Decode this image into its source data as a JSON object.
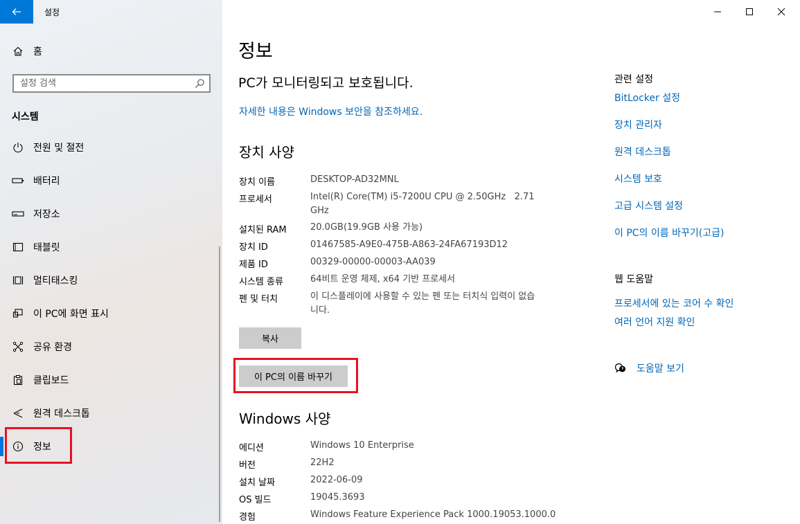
{
  "window": {
    "title": "설정",
    "controls": [
      "minimize-icon",
      "maximize-icon",
      "close-icon"
    ]
  },
  "sidebar": {
    "home_label": "홈",
    "search": {
      "placeholder": "설정 검색"
    },
    "section_label": "시스템",
    "items": [
      {
        "label": "전원 및 절전",
        "icon": "power-icon"
      },
      {
        "label": "배터리",
        "icon": "battery-icon"
      },
      {
        "label": "저장소",
        "icon": "storage-icon"
      },
      {
        "label": "태블릿",
        "icon": "tablet-icon"
      },
      {
        "label": "멀티태스킹",
        "icon": "multitasking-icon"
      },
      {
        "label": "이 PC에 화면 표시",
        "icon": "projecting-icon"
      },
      {
        "label": "공유 환경",
        "icon": "shared-experiences-icon"
      },
      {
        "label": "클립보드",
        "icon": "clipboard-icon"
      },
      {
        "label": "원격 데스크톱",
        "icon": "remote-desktop-icon"
      },
      {
        "label": "정보",
        "icon": "info-icon",
        "active": true
      }
    ]
  },
  "main": {
    "title": "정보",
    "protection_status": "PC가 모니터링되고 보호됩니다.",
    "security_link": "자세한 내용은 Windows 보안을 참조하세요.",
    "device_specs": {
      "heading": "장치 사양",
      "rows": [
        {
          "label": "장치 이름",
          "value": "DESKTOP-AD32MNL"
        },
        {
          "label": "프로세서",
          "value": "Intel(R) Core(TM) i5-7200U CPU @ 2.50GHz   2.71 GHz"
        },
        {
          "label": "설치된 RAM",
          "value": "20.0GB(19.9GB 사용 가능)"
        },
        {
          "label": "장치 ID",
          "value": "01467585-A9E0-475B-A863-24FA67193D12"
        },
        {
          "label": "제품 ID",
          "value": "00329-00000-00003-AA039"
        },
        {
          "label": "시스템 종류",
          "value": "64비트 운영 체제, x64 기반 프로세서"
        },
        {
          "label": "펜 및 터치",
          "value": "이 디스플레이에 사용할 수 있는 펜 또는 터치식 입력이 없습니다."
        }
      ],
      "copy_button": "복사",
      "rename_button": "이 PC의 이름 바꾸기"
    },
    "windows_specs": {
      "heading": "Windows 사양",
      "rows": [
        {
          "label": "에디션",
          "value": "Windows 10 Enterprise"
        },
        {
          "label": "버전",
          "value": "22H2"
        },
        {
          "label": "설치 날짜",
          "value": "2022-06-09"
        },
        {
          "label": "OS 빌드",
          "value": "19045.3693"
        },
        {
          "label": "경험",
          "value": "Windows Feature Experience Pack 1000.19053.1000.0"
        }
      ]
    }
  },
  "related": {
    "heading": "관련 설정",
    "links": [
      "BitLocker 설정",
      "장치 관리자",
      "원격 데스크톱",
      "시스템 보호",
      "고급 시스템 설정",
      "이 PC의 이름 바꾸기(고급)"
    ]
  },
  "help": {
    "heading": "웹 도움말",
    "links": [
      "프로세서에 있는 코어 수 확인",
      "여러 언어 지원 확인"
    ],
    "get_help": "도움말 보기"
  },
  "colors": {
    "accent": "#0078d7",
    "link": "#0067b8",
    "highlight": "#e81123",
    "button": "#cccccc"
  }
}
